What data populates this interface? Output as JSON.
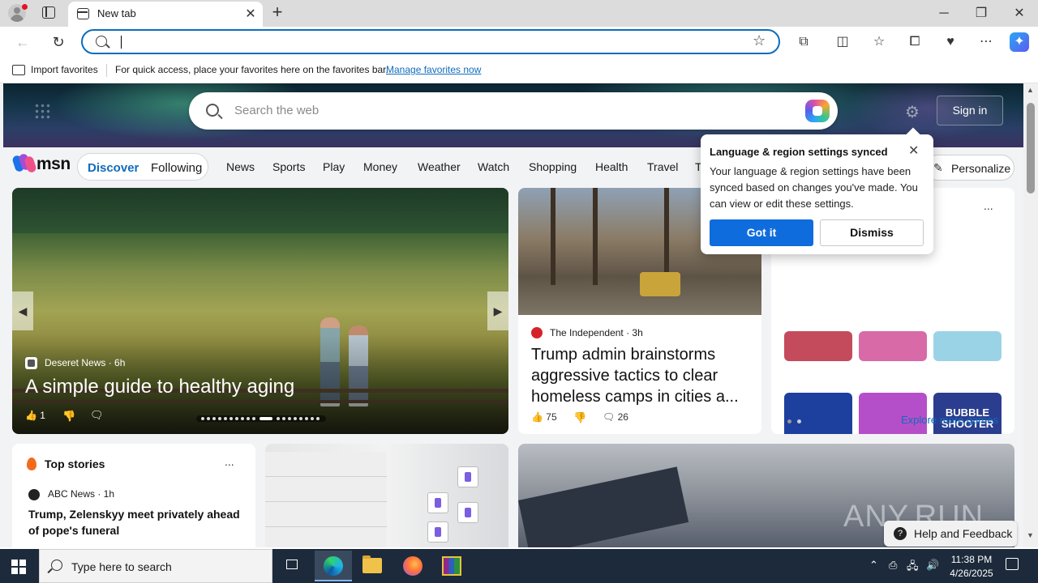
{
  "browser": {
    "tab_title": "New tab",
    "tab_close_icon": "close-icon",
    "new_tab_icon": "plus-icon",
    "window_controls": {
      "minimize": "─",
      "restore": "❐",
      "close": "✕"
    },
    "address_value": "",
    "address_placeholder": ""
  },
  "favorites_bar": {
    "import_label": "Import favorites",
    "hint_text": "For quick access, place your favorites here on the favorites bar.",
    "manage_link": "Manage favorites now"
  },
  "msn_header": {
    "search_placeholder": "Search the web",
    "sign_in_label": "Sign in",
    "logo_text": "msn"
  },
  "msn_nav": {
    "segments": [
      "Discover",
      "Following"
    ],
    "links": [
      "News",
      "Sports",
      "Play",
      "Money",
      "Weather",
      "Watch",
      "Shopping",
      "Health",
      "Travel",
      "T"
    ],
    "personalize_label": "Personalize"
  },
  "hero_card": {
    "source": "Deseret News · 6h",
    "title": "A simple guide to healthy aging",
    "likes": "1"
  },
  "news_card": {
    "source": "The Independent · 3h",
    "title": "Trump admin brainstorms aggressive tactics to clear homeless camps in cities a...",
    "likes": "75",
    "comments": "26"
  },
  "games_card": {
    "more_label": "...",
    "explore_label": "Explore more games",
    "tiles": [
      {
        "label": "",
        "color": "#c44b5c"
      },
      {
        "label": "",
        "color": "#d86aa8"
      },
      {
        "label": "",
        "color": "#9bd3e6"
      },
      {
        "label": "",
        "color": "#1d3f9e"
      },
      {
        "label": "",
        "color": "#b54fc9"
      },
      {
        "label": "BUBBLE SHOOTER",
        "color": "#2a3d8f"
      },
      {
        "label": "",
        "color": "#e9c38a"
      },
      {
        "label": "",
        "color": "#2e6e3b"
      },
      {
        "label": "",
        "color": "#f3d489"
      }
    ]
  },
  "popup": {
    "title": "Language & region settings synced",
    "body": "Your language & region settings have been synced based on changes you've made. You can view or edit these settings.",
    "primary_label": "Got it",
    "secondary_label": "Dismiss"
  },
  "top_stories": {
    "title": "Top stories",
    "more_label": "...",
    "source": "ABC News · 1h",
    "headline": "Trump, Zelenskyy meet privately ahead of pope's funeral"
  },
  "help": {
    "label": "Help and Feedback",
    "watermark": "ANY.RUN"
  },
  "taskbar": {
    "search_placeholder": "Type here to search",
    "time": "11:38 PM",
    "date": "4/26/2025"
  }
}
